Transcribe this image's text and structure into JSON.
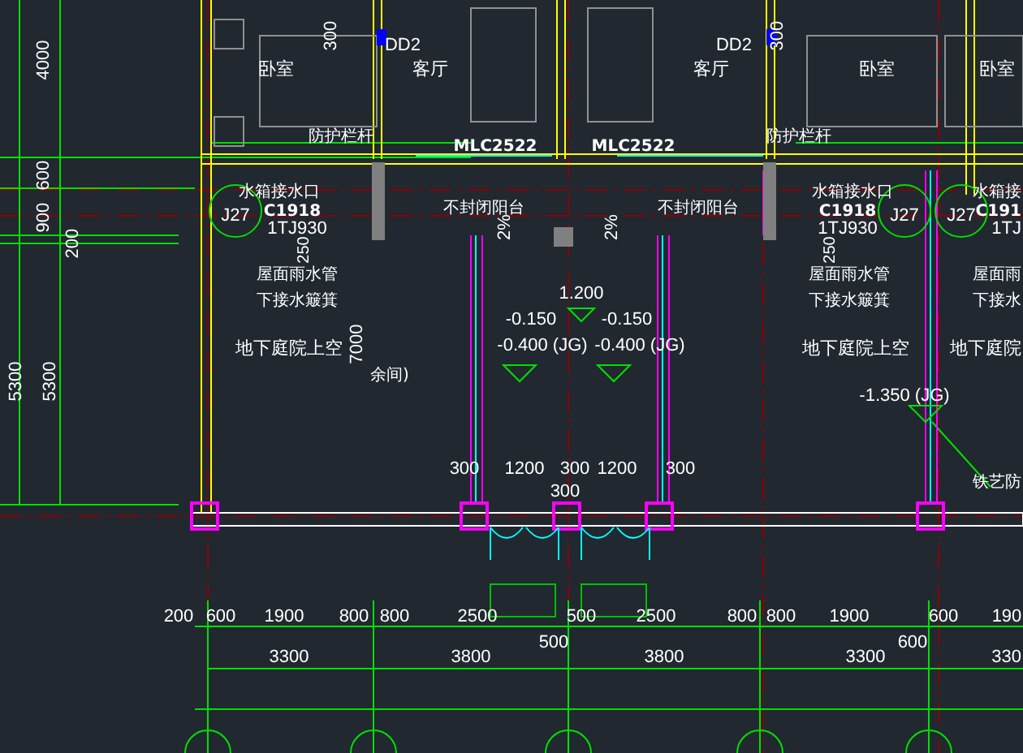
{
  "drawing": {
    "labels": [
      {
        "text": "4000",
        "kind": "dimension"
      },
      {
        "text": "300",
        "kind": "dimension"
      },
      {
        "text": "DD2",
        "kind": "tag"
      },
      {
        "text": "卧室",
        "kind": "room"
      },
      {
        "text": "客厅",
        "kind": "room"
      },
      {
        "text": "DD2",
        "kind": "tag"
      },
      {
        "text": "300",
        "kind": "dimension"
      },
      {
        "text": "客厅",
        "kind": "room"
      },
      {
        "text": "卧室",
        "kind": "room"
      },
      {
        "text": "卧室",
        "kind": "room"
      },
      {
        "text": "防护栏杆",
        "kind": "note"
      },
      {
        "text": "防护栏杆",
        "kind": "note"
      },
      {
        "text": "MLC2522",
        "kind": "door_code"
      },
      {
        "text": "MLC2522",
        "kind": "door_code"
      },
      {
        "text": "600",
        "kind": "dimension"
      },
      {
        "text": "900",
        "kind": "dimension"
      },
      {
        "text": "200",
        "kind": "dimension"
      },
      {
        "text": "水箱接水口",
        "kind": "note"
      },
      {
        "text": "水箱接水口",
        "kind": "note"
      },
      {
        "text": "水箱接",
        "kind": "note"
      },
      {
        "text": "不封闭阳台",
        "kind": "note"
      },
      {
        "text": "不封闭阳台",
        "kind": "note"
      },
      {
        "text": "J27",
        "kind": "tag"
      },
      {
        "text": "C1918",
        "kind": "door_code"
      },
      {
        "text": "C1918",
        "kind": "door_code"
      },
      {
        "text": "J27",
        "kind": "tag"
      },
      {
        "text": "J27",
        "kind": "tag"
      },
      {
        "text": "C191",
        "kind": "door_code"
      },
      {
        "text": "1TJ930",
        "kind": "tag"
      },
      {
        "text": "1TJ930",
        "kind": "tag"
      },
      {
        "text": "1TJ",
        "kind": "tag"
      },
      {
        "text": "2%",
        "kind": "dimension"
      },
      {
        "text": "2%",
        "kind": "dimension"
      },
      {
        "text": "250",
        "kind": "dimension"
      },
      {
        "text": "250",
        "kind": "dimension"
      },
      {
        "text": "屋面雨水管",
        "kind": "note"
      },
      {
        "text": "屋面雨水管",
        "kind": "note"
      },
      {
        "text": "屋面雨",
        "kind": "note"
      },
      {
        "text": "下接水簸箕",
        "kind": "note"
      },
      {
        "text": "下接水簸箕",
        "kind": "note"
      },
      {
        "text": "下接水",
        "kind": "note"
      },
      {
        "text": "地下庭院上空",
        "kind": "room"
      },
      {
        "text": "地下庭院上空",
        "kind": "room"
      },
      {
        "text": "地下庭院",
        "kind": "room"
      },
      {
        "text": "7000",
        "kind": "dimension"
      },
      {
        "text": "余间)",
        "kind": "note"
      },
      {
        "text": "5300",
        "kind": "dimension"
      },
      {
        "text": "5300",
        "kind": "dimension"
      },
      {
        "text": "1.200",
        "kind": "elevation"
      },
      {
        "text": "-0.150",
        "kind": "elevation"
      },
      {
        "text": "-0.150",
        "kind": "elevation"
      },
      {
        "text": "-0.400 (JG)",
        "kind": "elevation"
      },
      {
        "text": "-0.400 (JG)",
        "kind": "elevation"
      },
      {
        "text": "-1.350 (JG)",
        "kind": "elevation"
      },
      {
        "text": "铁艺防",
        "kind": "note"
      },
      {
        "text": "300",
        "kind": "dimension"
      },
      {
        "text": "1200",
        "kind": "dimension"
      },
      {
        "text": "300",
        "kind": "dimension"
      },
      {
        "text": "1200",
        "kind": "dimension"
      },
      {
        "text": "300",
        "kind": "dimension"
      },
      {
        "text": "300",
        "kind": "dimension"
      },
      {
        "text": "200",
        "kind": "dimension"
      },
      {
        "text": "600",
        "kind": "dimension"
      },
      {
        "text": "1900",
        "kind": "dimension"
      },
      {
        "text": "800",
        "kind": "dimension"
      },
      {
        "text": "800",
        "kind": "dimension"
      },
      {
        "text": "2500",
        "kind": "dimension"
      },
      {
        "text": "500",
        "kind": "dimension"
      },
      {
        "text": "2500",
        "kind": "dimension"
      },
      {
        "text": "800",
        "kind": "dimension"
      },
      {
        "text": "800",
        "kind": "dimension"
      },
      {
        "text": "1900",
        "kind": "dimension"
      },
      {
        "text": "600",
        "kind": "dimension"
      },
      {
        "text": "190",
        "kind": "dimension"
      },
      {
        "text": "500",
        "kind": "dimension"
      },
      {
        "text": "600",
        "kind": "dimension"
      },
      {
        "text": "3300",
        "kind": "dimension"
      },
      {
        "text": "3800",
        "kind": "dimension"
      },
      {
        "text": "3800",
        "kind": "dimension"
      },
      {
        "text": "3300",
        "kind": "dimension"
      },
      {
        "text": "330",
        "kind": "dimension"
      }
    ]
  }
}
